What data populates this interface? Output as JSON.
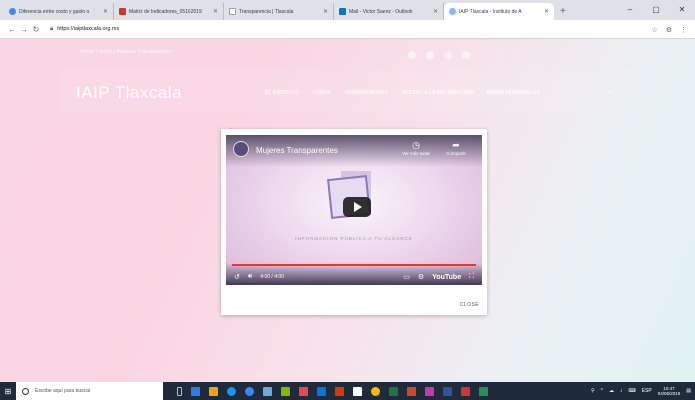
{
  "browser": {
    "tabs": [
      {
        "label": "Diferencia entre costo y gasto o",
        "color": "#4285f4",
        "active": false
      },
      {
        "label": "Matriz de Indicadores_05162019",
        "color": "#d93025",
        "active": false
      },
      {
        "label": "Transparencia | Tlaxcala",
        "color": "#9aa0a6",
        "active": false
      },
      {
        "label": "Mail - Victor Saenz - Outlook",
        "color": "#0078d4",
        "active": false
      },
      {
        "label": "IAIP Tlaxcala - Instituto de A",
        "color": "#8ab4f8",
        "active": true
      }
    ],
    "new_tab": "+",
    "url": "https://iaiptlaxcala.org.mx"
  },
  "site": {
    "breadcrumb": "Home  /  Inicio  /  Mujeres Transparentes",
    "logo": "IAIP Tlaxcala",
    "menu": [
      "EL INSTITUTO",
      "FOROS",
      "TRANSPARENCIA",
      "ACCESO A LA INFORMACIÓN",
      "DATOS PERSONALES"
    ]
  },
  "modal": {
    "video_title": "Mujeres Transparentes",
    "watch_later": "Ver más tarde",
    "share": "Compartir",
    "tagline": "INFORMACIÓN PÚBLICA A TU ALCANCE",
    "time": "4:00 / 4:00",
    "youtube": "YouTube",
    "close": "CLOSE"
  },
  "taskbar": {
    "search_placeholder": "Escribe aquí para buscar",
    "lang": "ESP",
    "time": "10:47",
    "date": "04/06/2019"
  },
  "colors": {
    "accent_red": "#e33",
    "taskbar": "#1f2a3a"
  }
}
